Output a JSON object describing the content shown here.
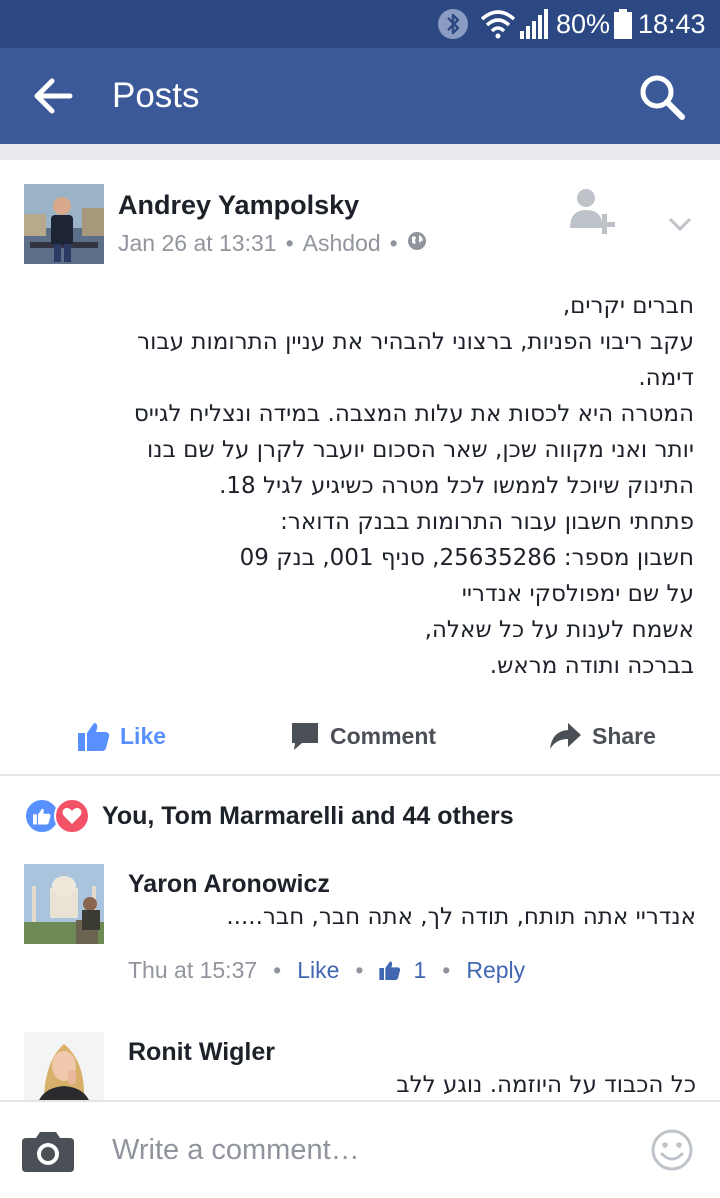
{
  "status_bar": {
    "battery": "80%",
    "time": "18:43"
  },
  "app_bar": {
    "title": "Posts",
    "back_icon": "arrow-left-icon",
    "search_icon": "search-icon"
  },
  "post": {
    "author": "Andrey Yampolsky",
    "date": "Jan 26 at 13:31",
    "separator": "•",
    "location": "Ashdod",
    "privacy_icon": "globe-icon",
    "lines": [
      "חברים יקרים,",
      "עקב ריבוי הפניות, ברצוני להבהיר את עניין התרומות עבור",
      "דימה.",
      "המטרה היא לכסות את עלות המצבה. במידה ונצליח לגייס",
      "יותר ואני מקווה שכן, שאר הסכום יועבר לקרן על שם בנו",
      "התינוק שיוכל לממשו לכל מטרה כשיגיע לגיל 18.",
      "פתחתי חשבון עבור התרומות בבנק הדואר:",
      "חשבון מספר: 25635286, סניף 001, בנק 09",
      "על שם ימפולסקי אנדריי",
      "אשמח לענות על כל שאלה,",
      "בברכה ותודה מראש."
    ],
    "actions": {
      "like": "Like",
      "comment": "Comment",
      "share": "Share"
    },
    "reactions": {
      "text": "You, Tom Marmarelli and 44 others"
    }
  },
  "comments": [
    {
      "name": "Yaron Aronowicz",
      "text": "אנדריי אתה תותח, תודה לך, אתה חבר, חבר.....",
      "time": "Thu at 15:37",
      "like_label": "Like",
      "like_count": "1",
      "reply_label": "Reply"
    },
    {
      "name": "Ronit Wigler",
      "text": "כל הכבוד על היוזמה. נוגע ללב"
    }
  ],
  "composer": {
    "placeholder": "Write a comment…",
    "camera_icon": "camera-icon",
    "emoji_icon": "smiley-icon"
  },
  "colors": {
    "brand": "#3b5998",
    "status_bar": "#2b4883",
    "link": "#4267b2",
    "like_blue": "#5890ff",
    "love_red": "#f25268"
  }
}
